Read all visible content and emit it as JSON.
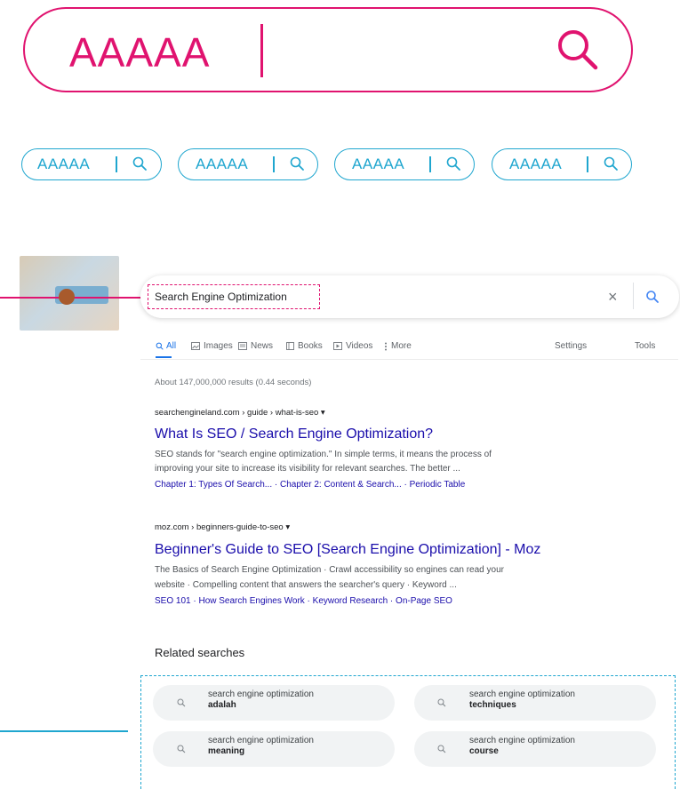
{
  "hero_search": {
    "text": "AAAAA"
  },
  "pills": [
    "AAAAA",
    "AAAAA",
    "AAAAA",
    "AAAAA"
  ],
  "google": {
    "query": "Search Engine Optimization",
    "clear_symbol": "×",
    "tabs": [
      "All",
      "Images",
      "News",
      "Books",
      "Videos",
      "More"
    ],
    "tabs_right": [
      "Settings",
      "Tools"
    ],
    "result_stats": "About 147,000,000 results (0.44 seconds)",
    "results": [
      {
        "cite": "searchengineland.com › guide › what-is-seo ▾",
        "title": "What Is SEO / Search Engine Optimization?",
        "snippet_1": "SEO stands for \"search engine optimization.\" In simple terms, it means the process of",
        "snippet_2": "improving your site to increase its visibility for relevant searches. The better ...",
        "sitelinks": "Chapter 1: Types Of Search... · Chapter 2: Content & Search... · Periodic Table"
      },
      {
        "cite": "moz.com › beginners-guide-to-seo ▾",
        "title": "Beginner's Guide to SEO [Search Engine Optimization] - Moz",
        "snippet_1": "The Basics of Search Engine Optimization · Crawl accessibility so engines can read your",
        "snippet_2": "website · Compelling content that answers the searcher's query · Keyword ...",
        "sitelinks": "SEO 101 · How Search Engines Work · Keyword Research · On-Page SEO"
      }
    ],
    "related_heading": "Related searches",
    "related": [
      {
        "prefix": "search engine optimization",
        "bold": "adalah"
      },
      {
        "prefix": "search engine optimization",
        "bold": "techniques"
      },
      {
        "prefix": "search engine optimization",
        "bold": "meaning"
      },
      {
        "prefix": "search engine optimization",
        "bold": "course"
      }
    ]
  },
  "colors": {
    "magenta": "#e0136f",
    "cyan": "#1fa6cf",
    "link": "#1a0dab"
  }
}
